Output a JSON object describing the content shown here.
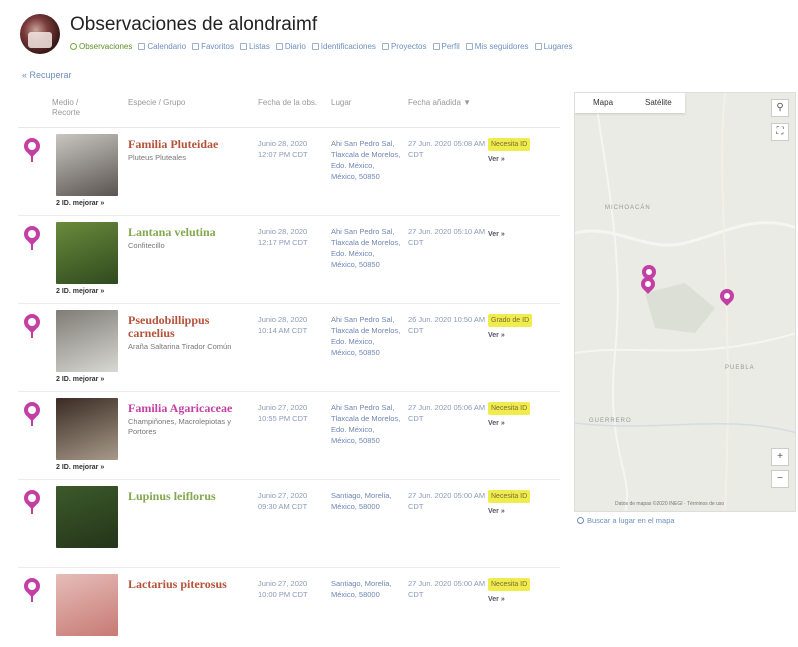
{
  "header": {
    "title": "Observaciones de alondraimf",
    "tabs": [
      {
        "label": "Observaciones",
        "active": true
      },
      {
        "label": "Calendario"
      },
      {
        "label": "Favoritos"
      },
      {
        "label": "Listas"
      },
      {
        "label": "Diario"
      },
      {
        "label": "Identificaciones"
      },
      {
        "label": "Proyectos"
      },
      {
        "label": "Perfil"
      },
      {
        "label": "Mis seguidores"
      },
      {
        "label": "Lugares"
      }
    ]
  },
  "breadcrumb": "« Recuperar",
  "table": {
    "columns": [
      "Medio / Recorte",
      "Especie / Grupo",
      "Fecha de la obs.",
      "Lugar",
      "Fecha añadida ▼",
      ""
    ],
    "rows": [
      {
        "name": "Familia Pluteidae",
        "subname": "Pluteus Pluteales",
        "name_color": "#b5523a",
        "thumb_colors": [
          "#c9c6c2",
          "#5a5450"
        ],
        "identifiers": "2 ID. mejorar »",
        "observed": "Junio 28, 2020 12:07 PM CDT",
        "place": "Ahi San Pedro Sal, Tlaxcala de Morelos, Edo. México, México, 50850",
        "added": "27 Jun. 2020 05:08 AM CDT",
        "status": "Necesita ID",
        "status_type": "badge"
      },
      {
        "name": "Lantana velutina",
        "subname": "Confitecillo",
        "name_color": "#82a84e",
        "thumb_colors": [
          "#6a8a3c",
          "#2f4a1e"
        ],
        "identifiers": "2 ID. mejorar »",
        "observed": "Junio 28, 2020 12:17 PM CDT",
        "place": "Ahi San Pedro Sal, Tlaxcala de Morelos, Edo. México, México, 50850",
        "added": "27 Jun. 2020 05:10 AM CDT",
        "status": "",
        "status_type": "ver"
      },
      {
        "name": "Pseudobillippus carnelius",
        "subname": "Araña Saltarina Tirador Común",
        "name_color": "#b5523a",
        "thumb_colors": [
          "#7e7c75",
          "#d8d8d3"
        ],
        "identifiers": "2 ID. mejorar »",
        "observed": "Junio 28, 2020 10:14 AM CDT",
        "place": "Ahi San Pedro Sal, Tlaxcala de Morelos, Edo. México, México, 50850",
        "added": "26 Jun. 2020 10:50 AM CDT",
        "status": "Grado de ID",
        "status_type": "needs"
      },
      {
        "name": "Familia Agaricaceae",
        "subname": "Champiñones, Macrolepiotas y Portores",
        "name_color": "#c43fa4",
        "thumb_colors": [
          "#3a2a22",
          "#a89a8a"
        ],
        "identifiers": "2 ID. mejorar »",
        "observed": "Junio 27, 2020 10:55 PM CDT",
        "place": "Ahi San Pedro Sal, Tlaxcala de Morelos, Edo. México, México, 50850",
        "added": "27 Jun. 2020 05:06 AM CDT",
        "status": "Necesita ID",
        "status_type": "badge"
      },
      {
        "name": "Lupinus leiflorus",
        "subname": "",
        "name_color": "#82a84e",
        "thumb_colors": [
          "#3c5a2a",
          "#24351a"
        ],
        "identifiers": "",
        "observed": "Junio 27, 2020 09:30 AM CDT",
        "place": "Santiago, Morelia, México, 58000",
        "added": "27 Jun. 2020 05:00 AM CDT",
        "status": "Necesita ID",
        "status_type": "badge"
      },
      {
        "name": "Lactarius piterosus",
        "subname": "",
        "name_color": "#b5523a",
        "thumb_colors": [
          "#e6bdb9",
          "#c77a73"
        ],
        "identifiers": "",
        "observed": "Junio 27, 2020 10:00 PM CDT",
        "place": "Santiago, Morelia, México, 58000",
        "added": "27 Jun. 2020 05:00 AM CDT",
        "status": "Necesita ID",
        "status_type": "badge"
      }
    ]
  },
  "map": {
    "tab_map": "Mapa",
    "tab_sat": "Satélite",
    "attribution": "Datos de mapas ©2020 INEGI · Términos de uso",
    "labels": [
      "MICHOACÁN",
      "PUEBLA",
      "GUERRERO"
    ],
    "zoom_in": "+",
    "zoom_out": "−",
    "below": "Buscar a lugar en el mapa"
  },
  "colors": {
    "pin": "#c43fa4",
    "link": "#6d8fbd",
    "badge": "#f0ec4d"
  }
}
